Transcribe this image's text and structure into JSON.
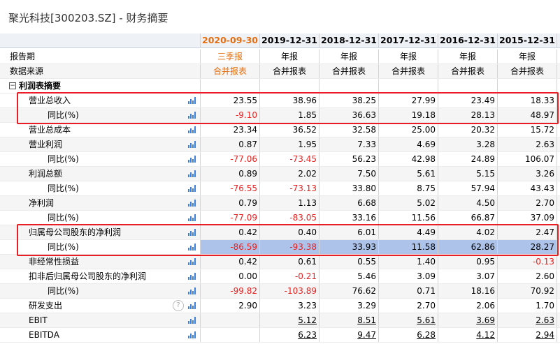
{
  "page_title": "聚光科技[300203.SZ] - 财务摘要",
  "columns": [
    {
      "date": "2020-09-30",
      "report_type": "三季报",
      "source": "合并报表",
      "highlight": true
    },
    {
      "date": "2019-12-31",
      "report_type": "年报",
      "source": "合并报表"
    },
    {
      "date": "2018-12-31",
      "report_type": "年报",
      "source": "合并报表"
    },
    {
      "date": "2017-12-31",
      "report_type": "年报",
      "source": "合并报表"
    },
    {
      "date": "2016-12-31",
      "report_type": "年报",
      "source": "合并报表"
    },
    {
      "date": "2015-12-31",
      "report_type": "年报",
      "source": "合并报表"
    }
  ],
  "header_labels": {
    "report_period": "报告期",
    "data_source": "数据来源"
  },
  "section": {
    "label": "利润表摘要",
    "toggle": "−"
  },
  "rows": [
    {
      "label": "营业总收入",
      "indent": 1,
      "values": [
        "23.55",
        "38.96",
        "38.25",
        "27.99",
        "23.49",
        "18.33"
      ]
    },
    {
      "label": "同比(%)",
      "indent": 2,
      "values": [
        "-9.10",
        "1.85",
        "36.63",
        "19.18",
        "28.13",
        "48.97"
      ]
    },
    {
      "label": "营业总成本",
      "indent": 1,
      "values": [
        "23.34",
        "36.52",
        "32.58",
        "25.00",
        "20.32",
        "15.72"
      ]
    },
    {
      "label": "营业利润",
      "indent": 1,
      "values": [
        "0.87",
        "1.95",
        "7.33",
        "4.69",
        "3.28",
        "2.63"
      ]
    },
    {
      "label": "同比(%)",
      "indent": 2,
      "values": [
        "-77.06",
        "-73.45",
        "56.23",
        "42.98",
        "24.89",
        "106.07"
      ]
    },
    {
      "label": "利润总额",
      "indent": 1,
      "values": [
        "0.89",
        "2.02",
        "7.50",
        "5.61",
        "5.15",
        "3.26"
      ]
    },
    {
      "label": "同比(%)",
      "indent": 2,
      "values": [
        "-76.55",
        "-73.13",
        "33.80",
        "8.75",
        "57.94",
        "43.43"
      ]
    },
    {
      "label": "净利润",
      "indent": 1,
      "values": [
        "0.79",
        "1.13",
        "6.68",
        "5.02",
        "4.50",
        "2.70"
      ]
    },
    {
      "label": "同比(%)",
      "indent": 2,
      "values": [
        "-77.09",
        "-83.05",
        "33.16",
        "11.56",
        "66.87",
        "37.09"
      ]
    },
    {
      "label": "归属母公司股东的净利润",
      "indent": 1,
      "values": [
        "0.42",
        "0.40",
        "6.01",
        "4.49",
        "4.02",
        "2.47"
      ]
    },
    {
      "label": "同比(%)",
      "indent": 2,
      "values": [
        "-86.59",
        "-93.38",
        "33.93",
        "11.58",
        "62.86",
        "28.27"
      ],
      "selected": true
    },
    {
      "label": "非经常性损益",
      "indent": 1,
      "values": [
        "0.42",
        "0.61",
        "0.55",
        "1.40",
        "0.95",
        "-0.13"
      ]
    },
    {
      "label": "扣非后归属母公司股东的净利润",
      "indent": 1,
      "values": [
        "0.00",
        "-0.21",
        "5.46",
        "3.09",
        "3.07",
        "2.60"
      ]
    },
    {
      "label": "同比(%)",
      "indent": 2,
      "values": [
        "-99.82",
        "-103.89",
        "76.62",
        "0.71",
        "18.16",
        "70.92"
      ]
    },
    {
      "label": "研发支出",
      "indent": 1,
      "help": "?",
      "values": [
        "2.90",
        "3.23",
        "3.29",
        "2.70",
        "2.06",
        "1.70"
      ]
    },
    {
      "label": "EBIT",
      "indent": 1,
      "values": [
        "",
        "5.12",
        "8.51",
        "5.61",
        "3.69",
        "2.63"
      ],
      "link": true
    },
    {
      "label": "EBITDA",
      "indent": 1,
      "values": [
        "",
        "6.23",
        "9.47",
        "6.28",
        "4.12",
        "2.94"
      ],
      "link": true
    }
  ],
  "colors": {
    "negative": "#e8201f",
    "current_period": "#e46e10",
    "chart_icon": "#3d7fd8",
    "annotation_box": "#ea1c24",
    "selection": "#aec3ea"
  }
}
